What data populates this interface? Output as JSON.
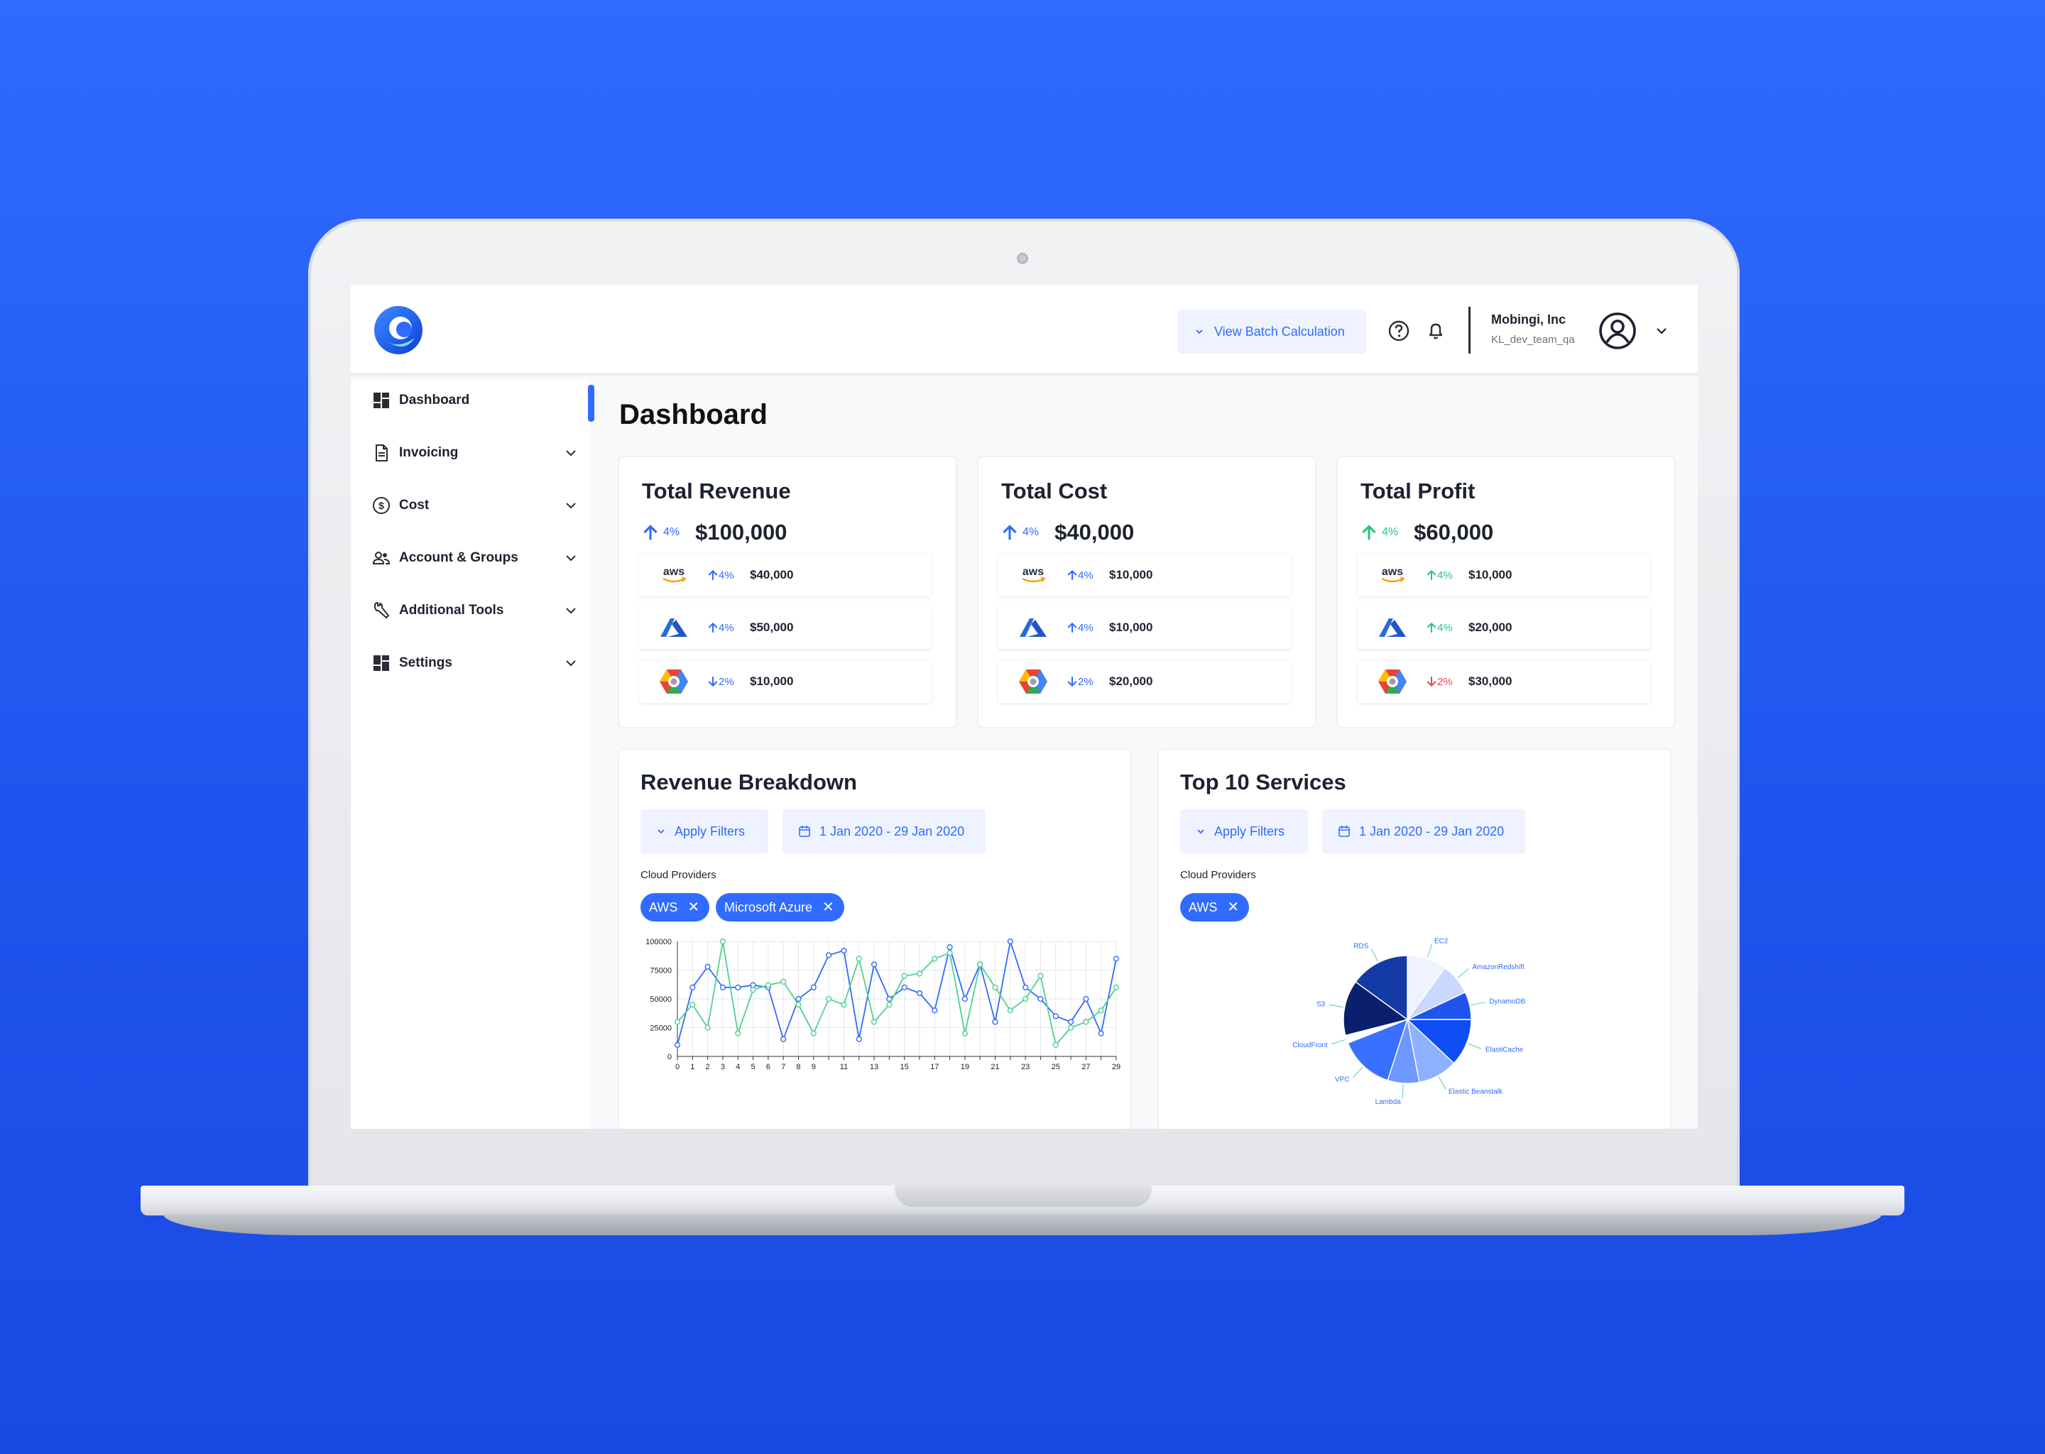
{
  "colors": {
    "accent": "#2f6bff",
    "up_blue": "#2f6bff",
    "up_green": "#27c47e",
    "down_red": "#e5484d",
    "series_green": "#4fd18c"
  },
  "header": {
    "batch_button": "View Batch Calculation",
    "org_name": "Mobingi, Inc",
    "org_team": "KL_dev_team_qa",
    "icons": [
      "help-icon",
      "bell-icon",
      "user-circle-icon",
      "chevron-down-icon"
    ]
  },
  "sidebar": {
    "items": [
      {
        "label": "Dashboard",
        "icon": "dashboard-icon",
        "active": true
      },
      {
        "label": "Invoicing",
        "icon": "document-icon"
      },
      {
        "label": "Cost",
        "icon": "dollar-icon"
      },
      {
        "label": "Account & Groups",
        "icon": "users-icon"
      },
      {
        "label": "Additional Tools",
        "icon": "wrench-icon"
      },
      {
        "label": "Settings",
        "icon": "grid-icon"
      }
    ]
  },
  "main": {
    "title": "Dashboard",
    "kpis": [
      {
        "title": "Total Revenue",
        "change": "4%",
        "direction": "up",
        "value": "$100,000",
        "providers": [
          {
            "name": "aws",
            "change": "4%",
            "direction": "up",
            "value": "$40,000"
          },
          {
            "name": "azure",
            "change": "4%",
            "direction": "up",
            "value": "$50,000"
          },
          {
            "name": "gcp",
            "change": "2%",
            "direction": "down",
            "value": "$10,000"
          }
        ]
      },
      {
        "title": "Total Cost",
        "change": "4%",
        "direction": "up",
        "value": "$40,000",
        "providers": [
          {
            "name": "aws",
            "change": "4%",
            "direction": "up",
            "value": "$10,000"
          },
          {
            "name": "azure",
            "change": "4%",
            "direction": "up",
            "value": "$10,000"
          },
          {
            "name": "gcp",
            "change": "2%",
            "direction": "down",
            "value": "$20,000"
          }
        ]
      },
      {
        "title": "Total Profit",
        "change": "4%",
        "direction": "up",
        "value": "$60,000",
        "providers": [
          {
            "name": "aws",
            "change": "4%",
            "direction": "up",
            "value": "$10,000"
          },
          {
            "name": "azure",
            "change": "4%",
            "direction": "up",
            "value": "$20,000"
          },
          {
            "name": "gcp",
            "change": "2%",
            "direction": "down",
            "value": "$30,000"
          }
        ]
      }
    ],
    "revenue": {
      "title": "Revenue Breakdown",
      "filter_label": "Apply Filters",
      "date_range": "1 Jan 2020 - 29 Jan 2020",
      "cloud_label": "Cloud Providers",
      "chips": [
        "AWS",
        "Microsoft Azure"
      ]
    },
    "top10": {
      "title": "Top 10 Services",
      "filter_label": "Apply Filters",
      "date_range": "1 Jan 2020 - 29 Jan 2020",
      "cloud_label": "Cloud Providers",
      "chips": [
        "AWS"
      ]
    }
  },
  "chart_data": [
    {
      "type": "line",
      "x": [
        0,
        1,
        2,
        3,
        4,
        5,
        6,
        7,
        8,
        9,
        10,
        11,
        12,
        13,
        14,
        15,
        16,
        17,
        18,
        19,
        20,
        21,
        22,
        23,
        24,
        25,
        26,
        27,
        28,
        29
      ],
      "x_tick_labels": [
        "0",
        "1",
        "2",
        "3",
        "4",
        "5",
        "6",
        "7",
        "8",
        "9",
        "11",
        "13",
        "15",
        "17",
        "19",
        "21",
        "23",
        "25",
        "27",
        "29"
      ],
      "x_tick_values": [
        0,
        1,
        2,
        3,
        4,
        5,
        6,
        7,
        8,
        9,
        11,
        13,
        15,
        17,
        19,
        21,
        23,
        25,
        27,
        29
      ],
      "y_ticks": [
        0,
        25000,
        50000,
        75000,
        100000
      ],
      "y_tick_labels": [
        "0",
        "25000",
        "50000",
        "75000",
        "100000"
      ],
      "ylim": [
        0,
        100000
      ],
      "grid": true,
      "series": [
        {
          "color": "#2f6bff",
          "values": [
            10000,
            60000,
            78000,
            60000,
            60000,
            62000,
            60000,
            15000,
            50000,
            60000,
            88000,
            92000,
            15000,
            80000,
            50000,
            60000,
            55000,
            40000,
            95000,
            50000,
            80000,
            30000,
            100000,
            60000,
            50000,
            35000,
            30000,
            50000,
            20000,
            85000
          ]
        },
        {
          "color": "#4fd18c",
          "values": [
            30000,
            45000,
            25000,
            100000,
            20000,
            58000,
            62000,
            65000,
            45000,
            20000,
            50000,
            45000,
            85000,
            30000,
            45000,
            70000,
            72000,
            85000,
            90000,
            20000,
            80000,
            60000,
            40000,
            50000,
            70000,
            10000,
            25000,
            30000,
            40000,
            60000
          ]
        }
      ]
    },
    {
      "type": "pie",
      "categories": [
        "EC2",
        "AmazonRedshift",
        "DynamoDB",
        "ElastiCache",
        "Elastic Beanstalk",
        "Lambda",
        "VPC",
        "CloudFront",
        "S3",
        "RDS"
      ],
      "values": [
        10,
        8,
        7,
        12,
        10,
        8,
        14,
        2,
        14,
        15
      ],
      "colors": [
        "#eef3ff",
        "#c9d8ff",
        "#1f55ee",
        "#0f4ef5",
        "#8fb0ff",
        "#6f98ff",
        "#3a70ff",
        "#ffffff",
        "#0a1f6e",
        "#143aa6"
      ]
    }
  ]
}
